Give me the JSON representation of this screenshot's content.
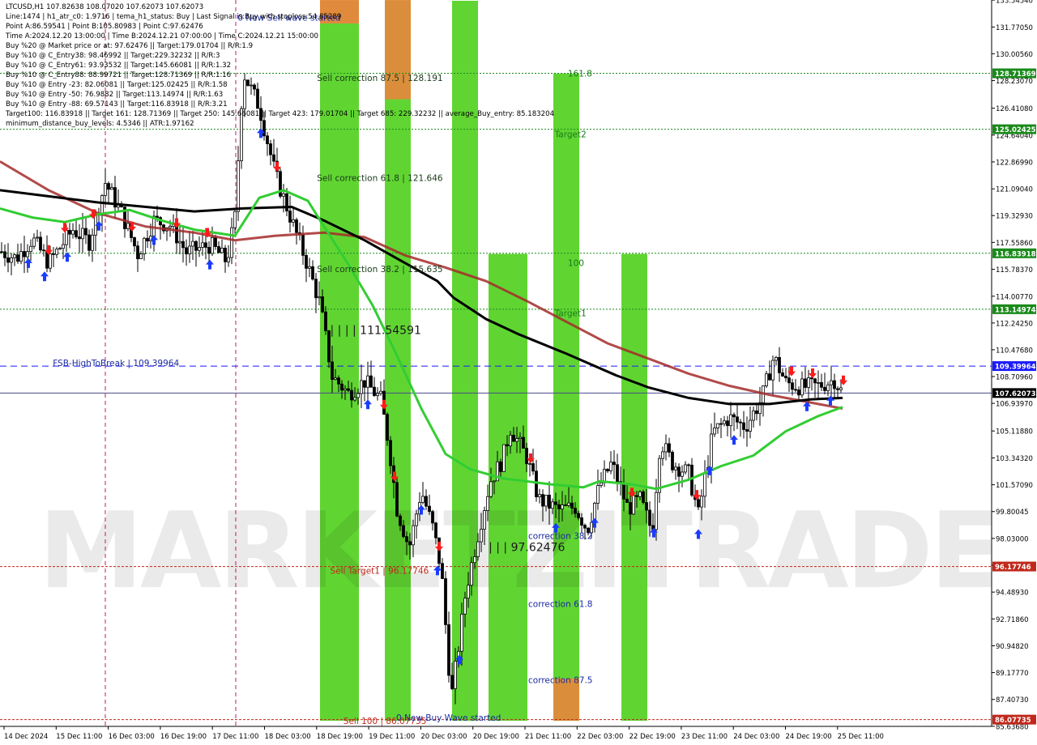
{
  "info_lines": [
    "LTCUSD,H1  107.82638 108.07020 107.62073 107.62073",
    "Line:1474 | h1_atr_c0: 1.9716 | tema_h1_status: Buy | Last Signal is:Buy with stoploss:54.85289",
    "Point A:86.59541 | Point B:105.80983 | Point C:97.62476",
    "Time A:2024.12.20 13:00:00 | Time B:2024.12.21 07:00:00 | Time C:2024.12.21 15:00:00",
    "Buy %20 @ Market price or at: 97.62476 || Target:179.01704 || R/R:1.9",
    "Buy %10 @ C_Entry38: 98.46992 || Target:229.32232 || R/R:3",
    "Buy %10 @ C_Entry61: 93.93532 || Target:145.66081 || R/R:1.32",
    "Buy %10 @ C_Entry88: 88.99721 || Target:128.71369 || R/R:1.16",
    "Buy %10 @ Entry -23: 82.06081 || Target:125.02425 || R/R:1.58",
    "Buy %10 @ Entry -50: 76.9882 || Target:113.14974 || R/R:1.63",
    "Buy %10 @ Entry -88: 69.57143 || Target:116.83918 || R/R:3.21",
    "Target100: 116.83918 || Target 161: 128.71369 || Target 250: 145.66081 || Target 423: 179.01704 || Target 685: 229.32232 || average_Buy_entry: 85.183204",
    "minimum_distance_buy_levels: 4.5346 || ATR:1.97162"
  ],
  "watermark": "MARKETZITRADE",
  "colors": {
    "bullish_candle": "#000000",
    "ema_black": "#000000",
    "ema_red": "#a52a2a",
    "ema_green": "#32cd32",
    "buy_arrow": "#1a3cff",
    "sell_arrow": "#ff1a1a",
    "green_band": "#4fd01c",
    "orange_band": "#e08a3c",
    "price_tag_green": "#1a8a1a",
    "price_tag_red": "#c0281b",
    "price_tag_black": "#000000"
  },
  "chart_data": {
    "type": "candlestick",
    "symbol": "LTCUSD,H1",
    "ylim": [
      85.63,
      133.55
    ],
    "y_ticks": [
      "133.54540",
      "131.77050",
      "130.00560",
      "128.23070",
      "126.41080",
      "124.64040",
      "122.86990",
      "121.09040",
      "119.32930",
      "117.55860",
      "115.78370",
      "114.00770",
      "112.24250",
      "110.47680",
      "108.70960",
      "106.93970",
      "105.11880",
      "103.34320",
      "101.57090",
      "99.80045",
      "98.03000",
      "96.26000",
      "94.48930",
      "92.71860",
      "90.94820",
      "89.17770",
      "87.40730",
      "85.63680"
    ],
    "x_ticks": [
      "14 Dec 2024",
      "15 Dec 11:00",
      "16 Dec 03:00",
      "16 Dec 19:00",
      "17 Dec 11:00",
      "18 Dec 03:00",
      "18 Dec 19:00",
      "19 Dec 11:00",
      "20 Dec 03:00",
      "20 Dec 19:00",
      "21 Dec 11:00",
      "22 Dec 03:00",
      "22 Dec 19:00",
      "23 Dec 11:00",
      "24 Dec 03:00",
      "24 Dec 19:00",
      "25 Dec 11:00"
    ],
    "price_tags": [
      {
        "label": "128.71369",
        "value": 128.71369,
        "color": "green"
      },
      {
        "label": "125.02425",
        "value": 125.02425,
        "color": "green"
      },
      {
        "label": "116.83918",
        "value": 116.83918,
        "color": "green"
      },
      {
        "label": "113.14974",
        "value": 113.14974,
        "color": "green"
      },
      {
        "label": "109.39964",
        "value": 109.39964,
        "color": "blue"
      },
      {
        "label": "107.62073",
        "value": 107.62073,
        "color": "black"
      },
      {
        "label": "96.17746",
        "value": 96.17746,
        "color": "red"
      },
      {
        "label": "86.07735",
        "value": 86.07735,
        "color": "red"
      }
    ],
    "annotations": [
      {
        "text": "0 New Sell wave started",
        "value": 132.2,
        "x_index": 18
      },
      {
        "text": "Sell correction 87.5 | 128.191",
        "value": 128.2,
        "x_index": 24
      },
      {
        "text": "Sell correction 61.8 | 121.646",
        "value": 121.6,
        "x_index": 24
      },
      {
        "text": "Sell correction 38.2 | 115.635",
        "value": 115.6,
        "x_index": 24
      },
      {
        "text": "| | | | 111.54591",
        "value": 111.5,
        "x_index": 25
      },
      {
        "text": "FSB-HighToBreak | 109.39964",
        "value": 109.4,
        "x_index": 4
      },
      {
        "text": "Target2",
        "value": 124.5,
        "x_index": 42
      },
      {
        "text": "161.8",
        "value": 128.5,
        "x_index": 43
      },
      {
        "text": "100",
        "value": 116.0,
        "x_index": 43
      },
      {
        "text": "Target1",
        "value": 112.7,
        "x_index": 42
      },
      {
        "text": "correction 38.2",
        "value": 98.0,
        "x_index": 40
      },
      {
        "text": "| | | 97.62476",
        "value": 97.2,
        "x_index": 37
      },
      {
        "text": "correction 61.8",
        "value": 93.5,
        "x_index": 40
      },
      {
        "text": "correction 87.5",
        "value": 88.5,
        "x_index": 40
      },
      {
        "text": "Sell Target1 | 96.17746",
        "value": 95.7,
        "x_index": 25
      },
      {
        "text": "Sell 100 | 86.07735",
        "value": 85.8,
        "x_index": 26
      },
      {
        "text": "0 New Buy Wave started",
        "value": 86.0,
        "x_index": 30
      }
    ]
  }
}
